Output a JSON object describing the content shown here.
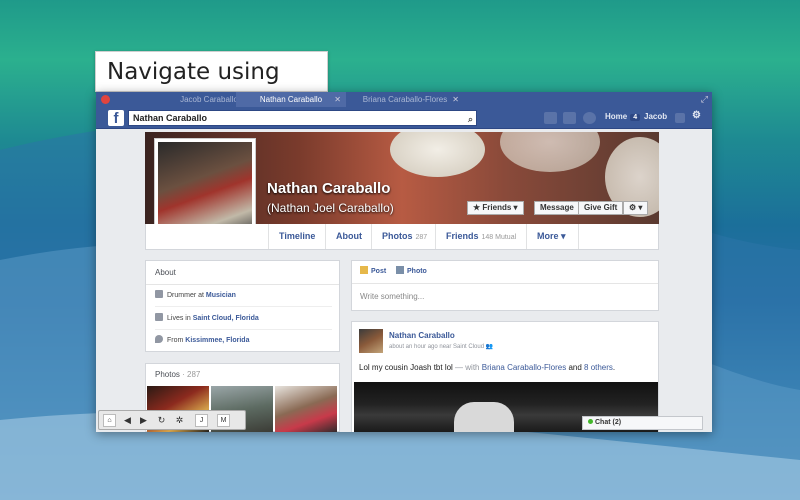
{
  "callout": "Navigate using tabs!",
  "window": {
    "tabs": [
      {
        "label": "Jacob Caraballo",
        "active": false
      },
      {
        "label": "Nathan Caraballo",
        "active": true,
        "close": "✕"
      },
      {
        "label": "Briana Caraballo-Flores",
        "active": false,
        "close": "✕"
      }
    ],
    "expand": "⤢"
  },
  "fbbar": {
    "logo": "f",
    "search_value": "Nathan Caraballo",
    "home_label": "Home",
    "home_count": "4",
    "user_label": "Jacob"
  },
  "profile": {
    "name": "Nathan Caraballo",
    "full_name": "(Nathan Joel Caraballo)",
    "friends_btn": "★ Friends ▾",
    "message_btn": "Message",
    "gift_btn": "Give Gift",
    "settings_btn": "⚙ ▾"
  },
  "tabs": [
    {
      "label": "Timeline",
      "count": ""
    },
    {
      "label": "About",
      "count": ""
    },
    {
      "label": "Photos",
      "count": "287"
    },
    {
      "label": "Friends",
      "count": "148 Mutual"
    },
    {
      "label": "More ▾",
      "count": ""
    }
  ],
  "about": {
    "title": "About",
    "work_prefix": "Drummer at ",
    "work_link": "Musician",
    "lives_prefix": "Lives in ",
    "lives_link": "Saint Cloud, Florida",
    "from_prefix": "From ",
    "from_link": "Kissimmee, Florida"
  },
  "photos": {
    "title": "Photos",
    "count": "· 287"
  },
  "composer": {
    "post_tab": "Post",
    "photo_tab": "Photo",
    "placeholder": "Write something..."
  },
  "post": {
    "author": "Nathan Caraballo",
    "meta": "about an hour ago near Saint Cloud",
    "text": "Lol my cousin Joash tbt lol",
    "with": " — with ",
    "tag1": "Briana Caraballo-Flores",
    "and": " and ",
    "tag2": "8 others",
    "end": "."
  },
  "chat": {
    "label": "Chat (2)"
  },
  "toolbar": {
    "home": "⌂",
    "back": "◀",
    "forward": "▶",
    "reload": "↻",
    "gear": "✲",
    "j": "J",
    "m": "M"
  }
}
